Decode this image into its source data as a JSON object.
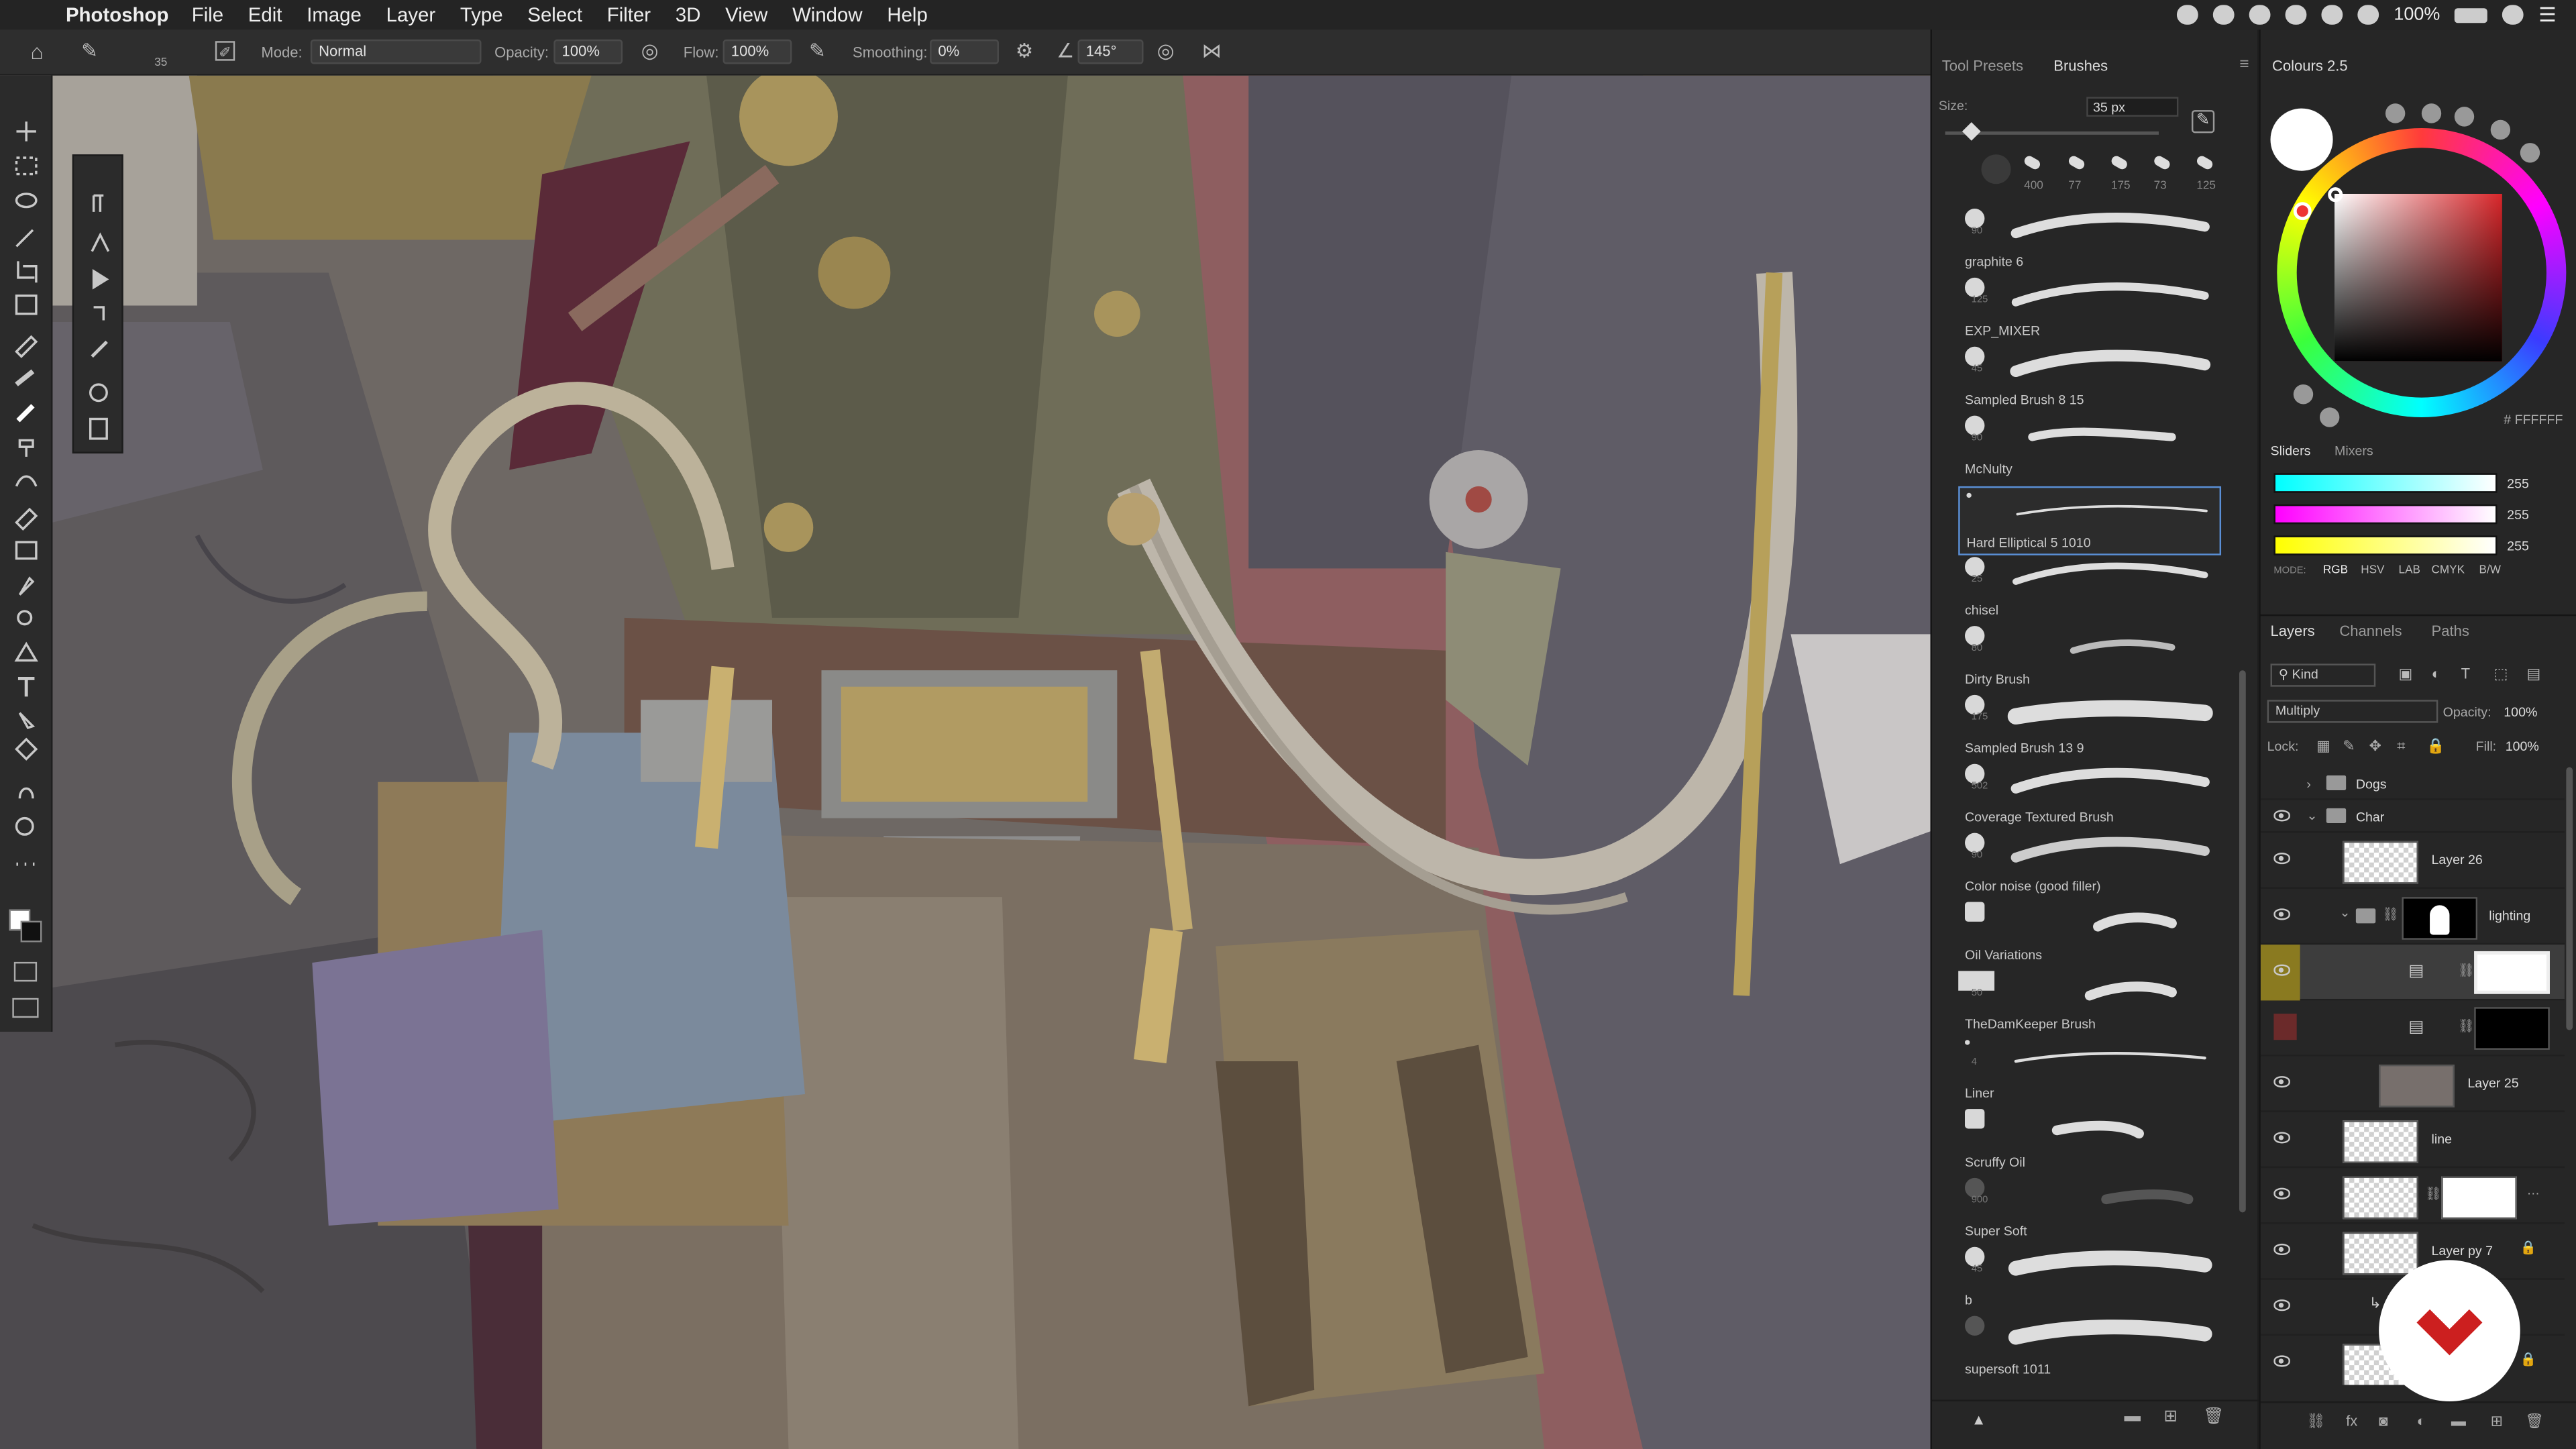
{
  "menubar": {
    "apple": "",
    "app": "Photoshop",
    "items": [
      "File",
      "Edit",
      "Image",
      "Layer",
      "Type",
      "Select",
      "Filter",
      "3D",
      "View",
      "Window",
      "Help"
    ],
    "battery": "100%"
  },
  "options": {
    "brush_size": "35",
    "mode_label": "Mode:",
    "mode": "Normal",
    "opacity_label": "Opacity:",
    "opacity": "100%",
    "flow_label": "Flow:",
    "flow": "100%",
    "smoothing_label": "Smoothing:",
    "smoothing": "0%",
    "angle": "145°"
  },
  "brushes_panel": {
    "tabs": [
      "Tool Presets",
      "Brushes"
    ],
    "size_label": "Size:",
    "size": "35 px",
    "recent_sizes": [
      "400",
      "77",
      "175",
      "73",
      "125"
    ],
    "items": [
      {
        "name": "graphite 6",
        "size": "90"
      },
      {
        "name": "EXP_MIXER",
        "size": "125"
      },
      {
        "name": "Sampled Brush 8 15",
        "size": "45"
      },
      {
        "name": "McNulty",
        "size": "90"
      },
      {
        "name": "Hard Elliptical 5 1010",
        "size": ""
      },
      {
        "name": "chisel",
        "size": "25"
      },
      {
        "name": "Dirty Brush",
        "size": "80"
      },
      {
        "name": "Sampled Brush 13 9",
        "size": "175"
      },
      {
        "name": "Coverage Textured Brush",
        "size": "502"
      },
      {
        "name": "Color noise (good filler)",
        "size": "90"
      },
      {
        "name": "Oil Variations",
        "size": ""
      },
      {
        "name": "TheDamKeeper Brush",
        "size": "50"
      },
      {
        "name": "Liner",
        "size": "4"
      },
      {
        "name": "Scruffy Oil",
        "size": ""
      },
      {
        "name": "Super Soft",
        "size": "900"
      },
      {
        "name": "b",
        "size": "45"
      },
      {
        "name": "supersoft 1011",
        "size": ""
      }
    ]
  },
  "colour_panel": {
    "title": "Colours 2.5",
    "hex": "# FFFFFF",
    "tabs": [
      "Sliders",
      "Mixers"
    ],
    "mode_label": "MODE:",
    "modes": [
      "RGB",
      "HSV",
      "LAB",
      "CMYK",
      "B/W"
    ],
    "values": [
      "255",
      "255",
      "255"
    ]
  },
  "layers_panel": {
    "tabs": [
      "Layers",
      "Channels",
      "Paths"
    ],
    "filter": "Kind",
    "blend": "Multiply",
    "opacity_label": "Opacity:",
    "opacity": "100%",
    "lock_label": "Lock:",
    "fill_label": "Fill:",
    "fill": "100%",
    "layers": [
      "Dogs",
      "Char",
      "Layer 26",
      "lighting",
      "",
      "",
      "Layer 25",
      "line",
      "",
      "Layer py 7",
      ""
    ]
  },
  "colors": {
    "accent": "#5a8fd6",
    "selected_layer_eye": "#8a7a20",
    "red_layer": "#6b2a2a",
    "logo": "#cc1f1f"
  }
}
